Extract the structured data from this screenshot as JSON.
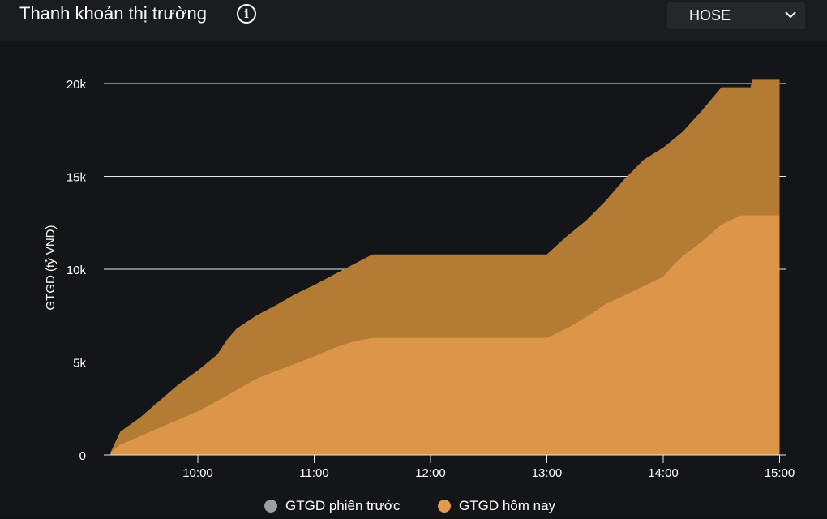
{
  "header": {
    "title": "Thanh khoản thị trường",
    "info_icon": "info-icon",
    "exchange_select": {
      "value": "HOSE",
      "icon": "chevron-down-icon"
    }
  },
  "chart_data": {
    "type": "area",
    "ylabel": "GTGD (tỷ VND)",
    "xlabel": "",
    "ylim": [
      0,
      20000
    ],
    "y_ticks": [
      0,
      5000,
      10000,
      15000,
      20000
    ],
    "y_tick_labels": [
      "0",
      "5k",
      "10k",
      "15k",
      "20k"
    ],
    "xlim": [
      "09:15",
      "15:00"
    ],
    "x_ticks": [
      "10:00",
      "11:00",
      "12:00",
      "13:00",
      "14:00",
      "15:00"
    ],
    "grid": true,
    "legend_position": "bottom",
    "series": [
      {
        "name": "GTGD phiên trước",
        "color": "#9e9e9e",
        "x": [
          "09:15",
          "09:20",
          "09:30",
          "09:40",
          "09:50",
          "10:00",
          "10:10",
          "10:15",
          "10:20",
          "10:30",
          "10:40",
          "10:50",
          "11:00",
          "11:10",
          "11:20",
          "11:30",
          "11:31",
          "12:00",
          "12:30",
          "13:00",
          "13:10",
          "13:20",
          "13:30",
          "13:40",
          "13:50",
          "14:00",
          "14:10",
          "14:20",
          "14:30",
          "14:45",
          "14:46",
          "15:00"
        ],
        "values": [
          150,
          1250,
          2000,
          2900,
          3800,
          4550,
          5400,
          6200,
          6800,
          7500,
          8050,
          8650,
          9150,
          9700,
          10250,
          10800,
          10800,
          10800,
          10800,
          10800,
          11750,
          12600,
          13650,
          14850,
          15900,
          16550,
          17400,
          18550,
          19800,
          19800,
          20200,
          20200
        ],
        "visible": false
      },
      {
        "name": "GTGD hôm nay",
        "color": "#e29a4c",
        "x": [
          "09:15",
          "09:20",
          "09:30",
          "09:40",
          "09:50",
          "10:00",
          "10:10",
          "10:20",
          "10:30",
          "10:40",
          "10:50",
          "11:00",
          "11:10",
          "11:20",
          "11:30",
          "11:31",
          "12:00",
          "12:30",
          "13:00",
          "13:10",
          "13:20",
          "13:30",
          "13:40",
          "13:50",
          "14:00",
          "14:05",
          "14:10",
          "14:20",
          "14:30",
          "14:40",
          "14:45",
          "15:00"
        ],
        "values": [
          150,
          550,
          1000,
          1450,
          1900,
          2350,
          2900,
          3500,
          4100,
          4500,
          4900,
          5300,
          5750,
          6100,
          6300,
          6300,
          6300,
          6300,
          6300,
          6800,
          7400,
          8100,
          8600,
          9100,
          9600,
          10200,
          10700,
          11500,
          12400,
          12900,
          12900,
          12900
        ]
      }
    ]
  },
  "legend": [
    {
      "label": "GTGD phiên trước",
      "color": "#9e9e9e"
    },
    {
      "label": "GTGD hôm nay",
      "color": "#e29a4c"
    }
  ]
}
